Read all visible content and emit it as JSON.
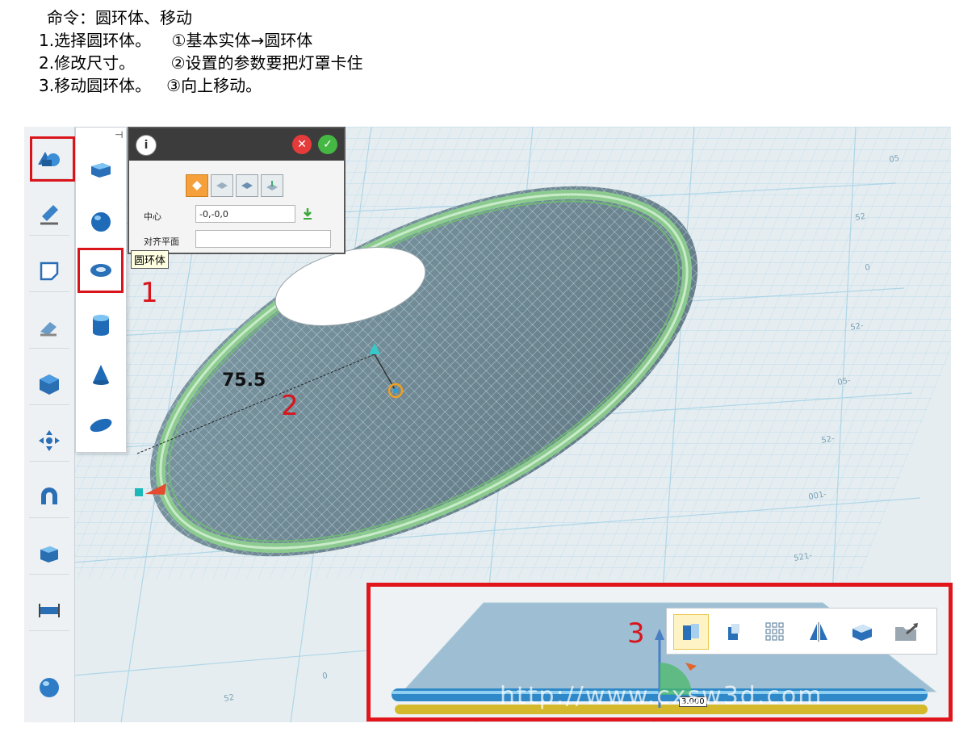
{
  "instructions": {
    "title": "命令：圆环体、移动",
    "rows": [
      {
        "step": "1.选择圆环体。",
        "detail": "①基本实体→圆环体"
      },
      {
        "step": "2.修改尺寸。",
        "detail": "②设置的参数要把灯罩卡住"
      },
      {
        "step": "3.移动圆环体。",
        "detail": "③向上移动。"
      }
    ]
  },
  "left_toolbar": {
    "items": [
      {
        "icon": "basic-solids-icon",
        "active": true
      },
      {
        "icon": "sketch-pen-icon"
      },
      {
        "icon": "sketch-surface-icon"
      },
      {
        "icon": "eraser-edit-icon"
      },
      {
        "icon": "cube-modify-icon"
      },
      {
        "icon": "move-arrows-icon"
      },
      {
        "icon": "magnet-snap-icon"
      },
      {
        "icon": "combine-solids-icon"
      },
      {
        "icon": "measure-ruler-icon"
      },
      {
        "icon": "sphere-render-icon"
      }
    ]
  },
  "submenu": {
    "items": [
      {
        "icon": "box-icon"
      },
      {
        "icon": "sphere-icon"
      },
      {
        "icon": "torus-icon",
        "selected": true
      },
      {
        "icon": "cylinder-icon"
      },
      {
        "icon": "cone-icon"
      },
      {
        "icon": "ellipsoid-icon"
      }
    ]
  },
  "tooltip": "圆环体",
  "dialog": {
    "center_label": "中心",
    "center_value": "-0,-0,0",
    "align_label": "对齐平面",
    "align_value": ""
  },
  "annotations": {
    "step1": "1",
    "step2": "2",
    "step3": "3",
    "dimension": "75.5"
  },
  "inset": {
    "value_tag": "3.000",
    "watermark": "http://www.cxsw3d.com"
  },
  "colors": {
    "accent_red": "#d9141b",
    "grid_blue": "#7fc7e6",
    "torus_green": "#9ad89a",
    "disc_fill": "#5f7d8a"
  }
}
